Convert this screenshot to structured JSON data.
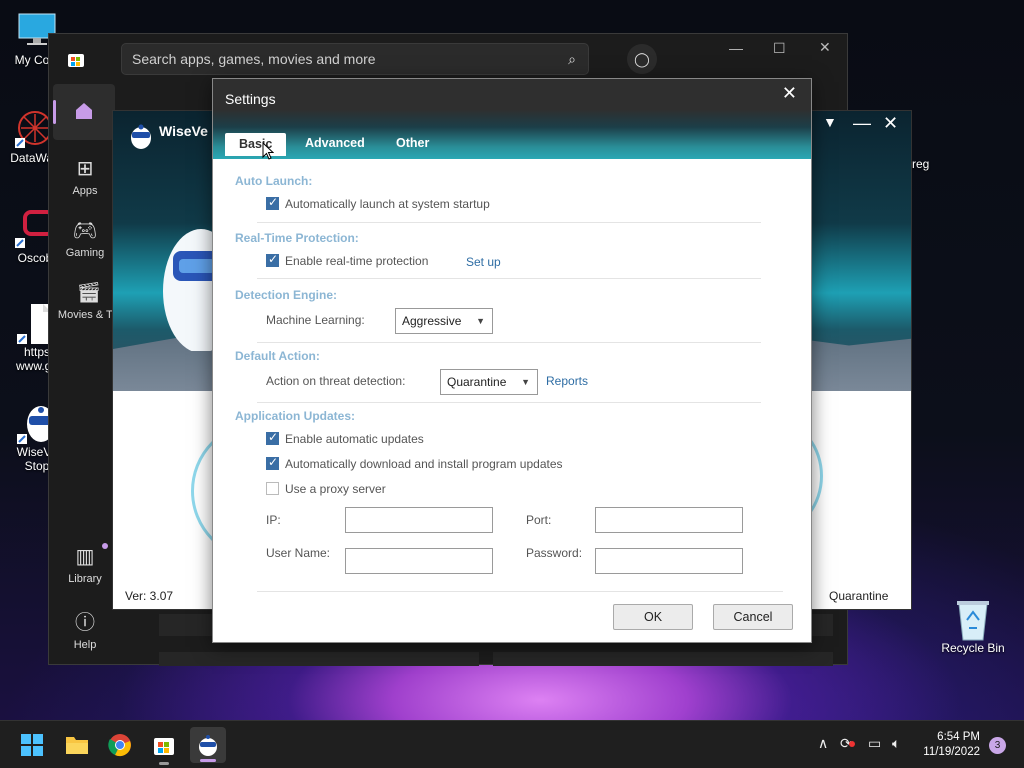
{
  "desktop": {
    "icons": [
      {
        "label": "My Com",
        "icon": "monitor-icon"
      },
      {
        "label": "DataWag",
        "icon": "datawag-icon"
      },
      {
        "label": "Oscob",
        "icon": "oscob-icon"
      },
      {
        "label1": "https",
        "label2": "www.go",
        "icon": "file-icon"
      },
      {
        "label1": "WiseVe",
        "label2": "Stop",
        "icon": "wisevector-icon"
      }
    ],
    "right_icons": [
      {
        "label": "reg"
      },
      {
        "label": "Recycle Bin",
        "icon": "recycle-bin-icon"
      }
    ]
  },
  "store": {
    "search_placeholder": "Search apps, games, movies and more",
    "nav": [
      {
        "label": "",
        "icon": "home-icon"
      },
      {
        "label": "Apps",
        "icon": "apps-icon"
      },
      {
        "label": "Gaming",
        "icon": "gamepad-icon"
      },
      {
        "label": "Movies & TV",
        "icon": "movie-icon"
      },
      {
        "label": "Library",
        "icon": "library-icon"
      },
      {
        "label": "Help",
        "icon": "help-icon"
      }
    ]
  },
  "wisevector": {
    "title": "WiseVe",
    "version": "Ver: 3.07",
    "status": "Quarantine"
  },
  "settings": {
    "title": "Settings",
    "tabs": [
      "Basic",
      "Advanced",
      "Other"
    ],
    "sections": {
      "auto_launch": "Auto Launch:",
      "realtime": "Real-Time Protection:",
      "engine": "Detection Engine:",
      "action": "Default Action:",
      "updates": "Application Updates:"
    },
    "auto_launch_label": "Automatically launch at system startup",
    "auto_launch_checked": true,
    "realtime_label": "Enable real-time protection",
    "realtime_checked": true,
    "setup_link": "Set up",
    "ml_label": "Machine Learning:",
    "ml_value": "Aggressive",
    "action_label": "Action on threat detection:",
    "action_value": "Quarantine",
    "reports_link": "Reports",
    "auto_update_label": "Enable automatic updates",
    "auto_update_checked": true,
    "auto_download_label": "Automatically download and install program updates",
    "auto_download_checked": true,
    "proxy_label": "Use a proxy server",
    "proxy_checked": false,
    "ip_label": "IP:",
    "port_label": "Port:",
    "username_label": "User Name:",
    "password_label": "Password:",
    "ok": "OK",
    "cancel": "Cancel"
  },
  "taskbar": {
    "time": "6:54 PM",
    "date": "11/19/2022",
    "notifications": "3"
  }
}
